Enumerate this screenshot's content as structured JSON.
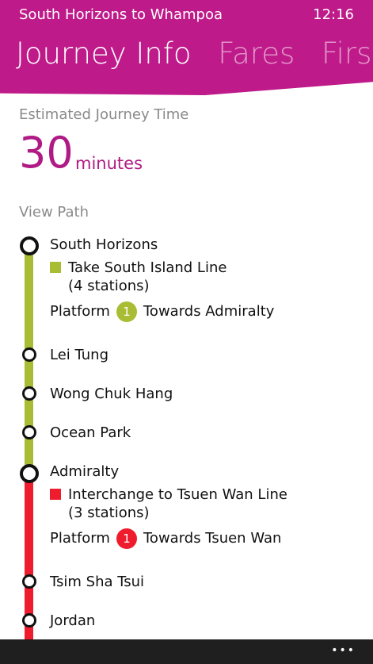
{
  "status": {
    "title": "South Horizons to Whampoa",
    "time": "12:16"
  },
  "pivot": {
    "tabs": [
      "Journey Info",
      "Fares",
      "First / L"
    ]
  },
  "journey": {
    "label": "Estimated Journey Time",
    "value": "30",
    "unit": "minutes"
  },
  "path": {
    "label": "View Path"
  },
  "colors": {
    "accent": "#b01a84",
    "south_island_line": "#a9bd34",
    "tsuen_wan_line": "#ef1c2e"
  },
  "route": {
    "leg1": {
      "origin": "South Horizons",
      "line": "Take South Island Line",
      "stations_count": "(4 stations)",
      "platform_label": "Platform",
      "platform_number": "1",
      "towards": "Towards Admiralty"
    },
    "stations1": [
      "Lei Tung",
      "Wong Chuk Hang",
      "Ocean Park"
    ],
    "leg2": {
      "interchange": "Admiralty",
      "line": "Interchange to Tsuen Wan Line",
      "stations_count": "(3 stations)",
      "platform_label": "Platform",
      "platform_number": "1",
      "towards": "Towards Tsuen Wan"
    },
    "stations2": [
      "Tsim Sha Tsui",
      "Jordan"
    ]
  },
  "appbar": {
    "more": "•••"
  }
}
